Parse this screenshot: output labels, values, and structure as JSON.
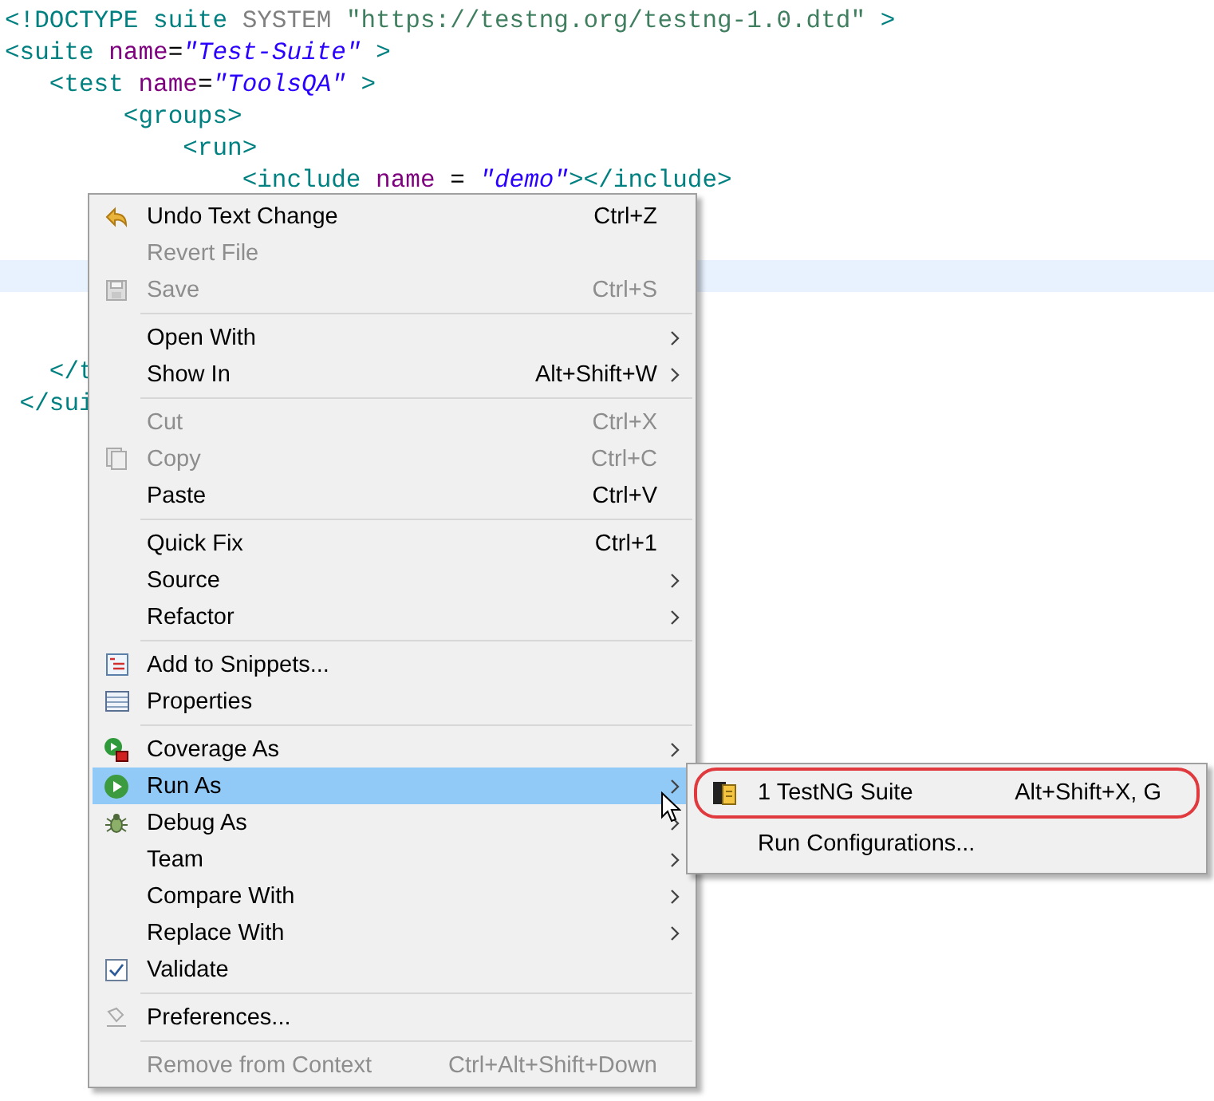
{
  "editor": {
    "lines": [
      {
        "current": false,
        "tokens": [
          {
            "kind": "tag",
            "text": "<!DOCTYPE "
          },
          {
            "kind": "tag",
            "text": "suite "
          },
          {
            "kind": "keyword",
            "text": "SYSTEM "
          },
          {
            "kind": "string",
            "text": "\"https://testng.org/testng-1.0.dtd\" "
          },
          {
            "kind": "tag",
            "text": ">"
          }
        ]
      },
      {
        "current": false,
        "tokens": [
          {
            "kind": "tag",
            "text": "<suite "
          },
          {
            "kind": "attr",
            "text": "name"
          },
          {
            "kind": "plain",
            "text": "="
          },
          {
            "kind": "value",
            "text": "\"Test-Suite\""
          },
          {
            "kind": "tag",
            "text": " >"
          }
        ]
      },
      {
        "current": false,
        "tokens": [
          {
            "kind": "tag",
            "text": "   <test "
          },
          {
            "kind": "attr",
            "text": "name"
          },
          {
            "kind": "plain",
            "text": "="
          },
          {
            "kind": "value",
            "text": "\"ToolsQA\""
          },
          {
            "kind": "tag",
            "text": " >"
          }
        ]
      },
      {
        "current": false,
        "tokens": [
          {
            "kind": "tag",
            "text": "        <groups>"
          }
        ]
      },
      {
        "current": false,
        "tokens": [
          {
            "kind": "tag",
            "text": "            <run>"
          }
        ]
      },
      {
        "current": false,
        "tokens": [
          {
            "kind": "tag",
            "text": "                <include "
          },
          {
            "kind": "attr",
            "text": "name"
          },
          {
            "kind": "plain",
            "text": " = "
          },
          {
            "kind": "value",
            "text": "\"demo\""
          },
          {
            "kind": "tag",
            "text": "></include>"
          }
        ]
      },
      {
        "current": false
      },
      {
        "current": false
      },
      {
        "current": true
      },
      {
        "current": false
      },
      {
        "current": false
      },
      {
        "current": false,
        "tokens": [
          {
            "kind": "tag",
            "text": "   </t"
          }
        ]
      },
      {
        "current": false,
        "tokens": [
          {
            "kind": "tag",
            "text": " </sui"
          }
        ]
      }
    ]
  },
  "context_menu": {
    "groups": [
      [
        {
          "label": "Undo Text Change",
          "shortcut": "Ctrl+Z",
          "disabled": false,
          "selected": false
        },
        {
          "label": "Revert File",
          "disabled": true,
          "selected": false
        },
        {
          "label": "Save",
          "shortcut": "Ctrl+S",
          "disabled": true,
          "selected": false
        }
      ],
      [
        {
          "label": "Open With",
          "disabled": false,
          "has_submenu": true,
          "selected": false
        },
        {
          "label": "Show In",
          "shortcut": "Alt+Shift+W",
          "disabled": false,
          "has_submenu": true,
          "selected": false
        }
      ],
      [
        {
          "label": "Cut",
          "shortcut": "Ctrl+X",
          "disabled": true,
          "selected": false
        },
        {
          "label": "Copy",
          "shortcut": "Ctrl+C",
          "disabled": true,
          "selected": false
        },
        {
          "label": "Paste",
          "shortcut": "Ctrl+V",
          "disabled": false,
          "selected": false
        }
      ],
      [
        {
          "label": "Quick Fix",
          "shortcut": "Ctrl+1",
          "disabled": false,
          "selected": false
        },
        {
          "label": "Source",
          "disabled": false,
          "has_submenu": true,
          "selected": false
        },
        {
          "label": "Refactor",
          "disabled": false,
          "has_submenu": true,
          "selected": false
        }
      ],
      [
        {
          "label": "Add to Snippets...",
          "disabled": false,
          "selected": false
        },
        {
          "label": "Properties",
          "disabled": false,
          "selected": false
        }
      ],
      [
        {
          "label": "Coverage As",
          "disabled": false,
          "has_submenu": true,
          "selected": false
        },
        {
          "label": "Run As",
          "disabled": false,
          "has_submenu": true,
          "selected": true,
          "submenu": [
            {
              "label": "1 TestNG Suite",
              "shortcut": "Alt+Shift+X, G",
              "circled": true
            },
            {
              "label": "Run Configurations...",
              "circled": false
            }
          ]
        },
        {
          "label": "Debug As",
          "disabled": false,
          "has_submenu": true,
          "selected": false
        },
        {
          "label": "Team",
          "disabled": false,
          "has_submenu": true,
          "selected": false
        },
        {
          "label": "Compare With",
          "disabled": false,
          "has_submenu": true,
          "selected": false
        },
        {
          "label": "Replace With",
          "disabled": false,
          "has_submenu": true,
          "selected": false
        },
        {
          "label": "Validate",
          "disabled": false,
          "checked": true,
          "selected": false
        }
      ],
      [
        {
          "label": "Preferences...",
          "disabled": false,
          "selected": false
        }
      ],
      [
        {
          "label": "Remove from Context",
          "shortcut": "Ctrl+Alt+Shift+Down",
          "disabled": true,
          "selected": false
        }
      ]
    ]
  }
}
